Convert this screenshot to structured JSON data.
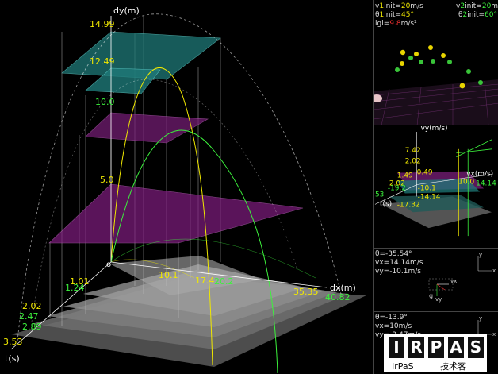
{
  "main_view": {
    "y_axis_label": "dy(m)",
    "x_axis_label": "dx(m)",
    "t_axis_label": "t(s)",
    "origin_label": "o",
    "y_ticks": {
      "a": "14.99",
      "b": "12.49",
      "c": "10.0",
      "d": "5.0"
    },
    "x_ticks": {
      "a": "10.1",
      "b": "17.4",
      "c": "20.2",
      "d": "35.35",
      "e": "40.82"
    },
    "t_ticks": {
      "a": "1.01",
      "b": "1.24",
      "c": "2.02",
      "d": "2.47",
      "e": "2.89",
      "f": "3.53"
    },
    "colors": {
      "series1": "#f0e800",
      "series2": "#3cf23c",
      "plane_magenta": "#8a1f8a",
      "plane_teal": "#1f7a78",
      "floor": "#8a8a8a"
    }
  },
  "info_panel": {
    "v1_prefix": "v",
    "v1_index": "1",
    "v1_suffix": "init=",
    "v1_value": "20",
    "v1_unit": "m/s",
    "v2_prefix": "v",
    "v2_index": "2",
    "v2_suffix": "init=",
    "v2_value": "20",
    "v2_unit": "m/s",
    "theta1_prefix": "θ",
    "theta1_index": "1",
    "theta1_suffix": "init=",
    "theta1_value": "45°",
    "theta2_prefix": "θ",
    "theta2_index": "2",
    "theta2_suffix": "init=",
    "theta2_value": "60°",
    "g_prefix": "lgl=",
    "g_value": "9.8",
    "g_unit": "m/s²"
  },
  "velocity_view": {
    "vy_label": "vy(m/s)",
    "vx_label": "vx(m/s)",
    "t_label": "t(s)",
    "ticks": {
      "a": "7.42",
      "b": "2.02",
      "c": "0.49",
      "d": "1.49",
      "e": "2.02",
      "f": "10.0",
      "g": "14.14",
      "h": "-10.1",
      "i": "-14.14",
      "j": "-17.32",
      "k": "53",
      "l": "-19.2"
    }
  },
  "component_panel_1": {
    "theta": "θ=-35.54°",
    "vx": "vx=14.14m/s",
    "vy": "vy=-10.1m/s",
    "axis_y": "y",
    "axis_x": "x",
    "vec_vx": "vx",
    "vec_g": "g",
    "vec_vy": "vy"
  },
  "component_panel_2": {
    "theta": "θ=-13.9°",
    "vx": "vx=10m/s",
    "vy": "vy=-2.47m/s",
    "axis_y": "y",
    "axis_x": "x"
  },
  "logo": {
    "letters": {
      "a": "I",
      "b": "R",
      "c": "P",
      "d": "A",
      "e": "S"
    },
    "sub_left": "IrPaS",
    "sub_right": "技术客"
  }
}
